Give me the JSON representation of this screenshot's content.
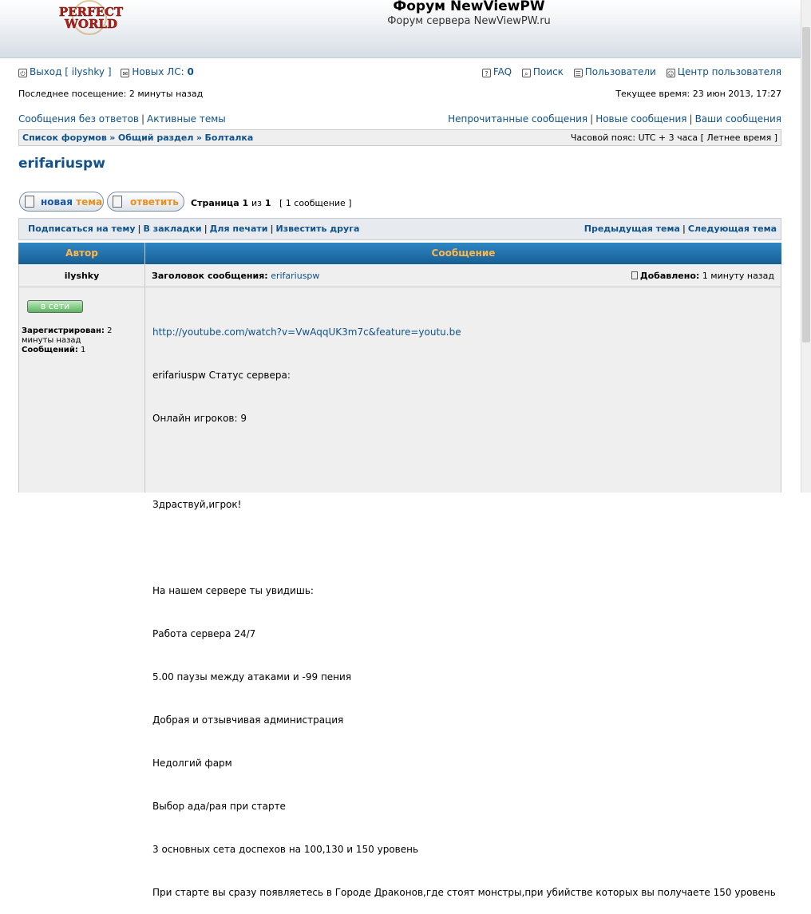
{
  "header": {
    "logo_top": "PERFECT",
    "logo_bottom": "WORLD",
    "title": "Форум NewViewPW",
    "description": "Форум сервера NewViewPW.ru"
  },
  "userbar": {
    "logout": "Выход [ ilyshky ]",
    "new_pm_label": "Новых ЛС:",
    "new_pm_count": "0",
    "faq": "FAQ",
    "search": "Поиск",
    "members": "Пользователи",
    "ucp": "Центр пользователя",
    "last_visit": "Последнее посещение: 2 минуты назад",
    "current_time": "Текущее время: 23 июн 2013, 17:27"
  },
  "quicklinks": {
    "unanswered": "Сообщения без ответов",
    "active": "Активные темы",
    "unread": "Непрочитанные сообщения",
    "new_posts": "Новые сообщения",
    "your_posts": "Ваши сообщения"
  },
  "breadcrumb": {
    "index": "Список форумов",
    "section": "Общий раздел",
    "forum": "Болталка",
    "timezone": "Часовой пояс: UTC + 3 часа [ Летнее время ]"
  },
  "topic": {
    "title": "erifariuspw",
    "new_topic_a": "новая",
    "new_topic_b": "тема",
    "reply": "ответить",
    "page_label": "Страница",
    "page_current": "1",
    "page_of": "из",
    "page_total": "1",
    "post_count": "[ 1 сообщение ]"
  },
  "actions": {
    "subscribe": "Подписаться на тему",
    "bookmark": "В закладки",
    "print": "Для печати",
    "email": "Известить друга",
    "prev": "Предыдущая тема",
    "next": "Следующая тема"
  },
  "table": {
    "col_author": "Автор",
    "col_message": "Сообщение"
  },
  "post": {
    "author": "ilyshky",
    "subject_label": "Заголовок сообщения:",
    "subject": "erifariuspw",
    "added_label": "Добавлено:",
    "added": "1 минуту назад",
    "online": "в сети",
    "registered_label": "Зарегистрирован:",
    "registered": "2 минуты назад",
    "posts_label": "Сообщений:",
    "posts": "1",
    "link": "http://youtube.com/watch?v=VwAqqUK3m7c&feature=youtu.be",
    "body": [
      "erifariuspw Статус сервера:",
      "Онлайн игроков: 9",
      "",
      "Здраствуй,игрок!",
      "",
      "На нашем сервере ты увидишь:",
      "Работа сервера 24/7",
      "5.00 паузы между атаками и -99 пения",
      "Добрая и отзывчивая администрация",
      "Недолгий фарм",
      "Выбор ада/рая при старте",
      "3 основных сета доспехов на 100,130 и 150 уровень",
      "При старте вы сразу появляетесь в Городе Драконов,где стоят монстры,при убийстве которых вы получаете 150 уровень"
    ]
  }
}
